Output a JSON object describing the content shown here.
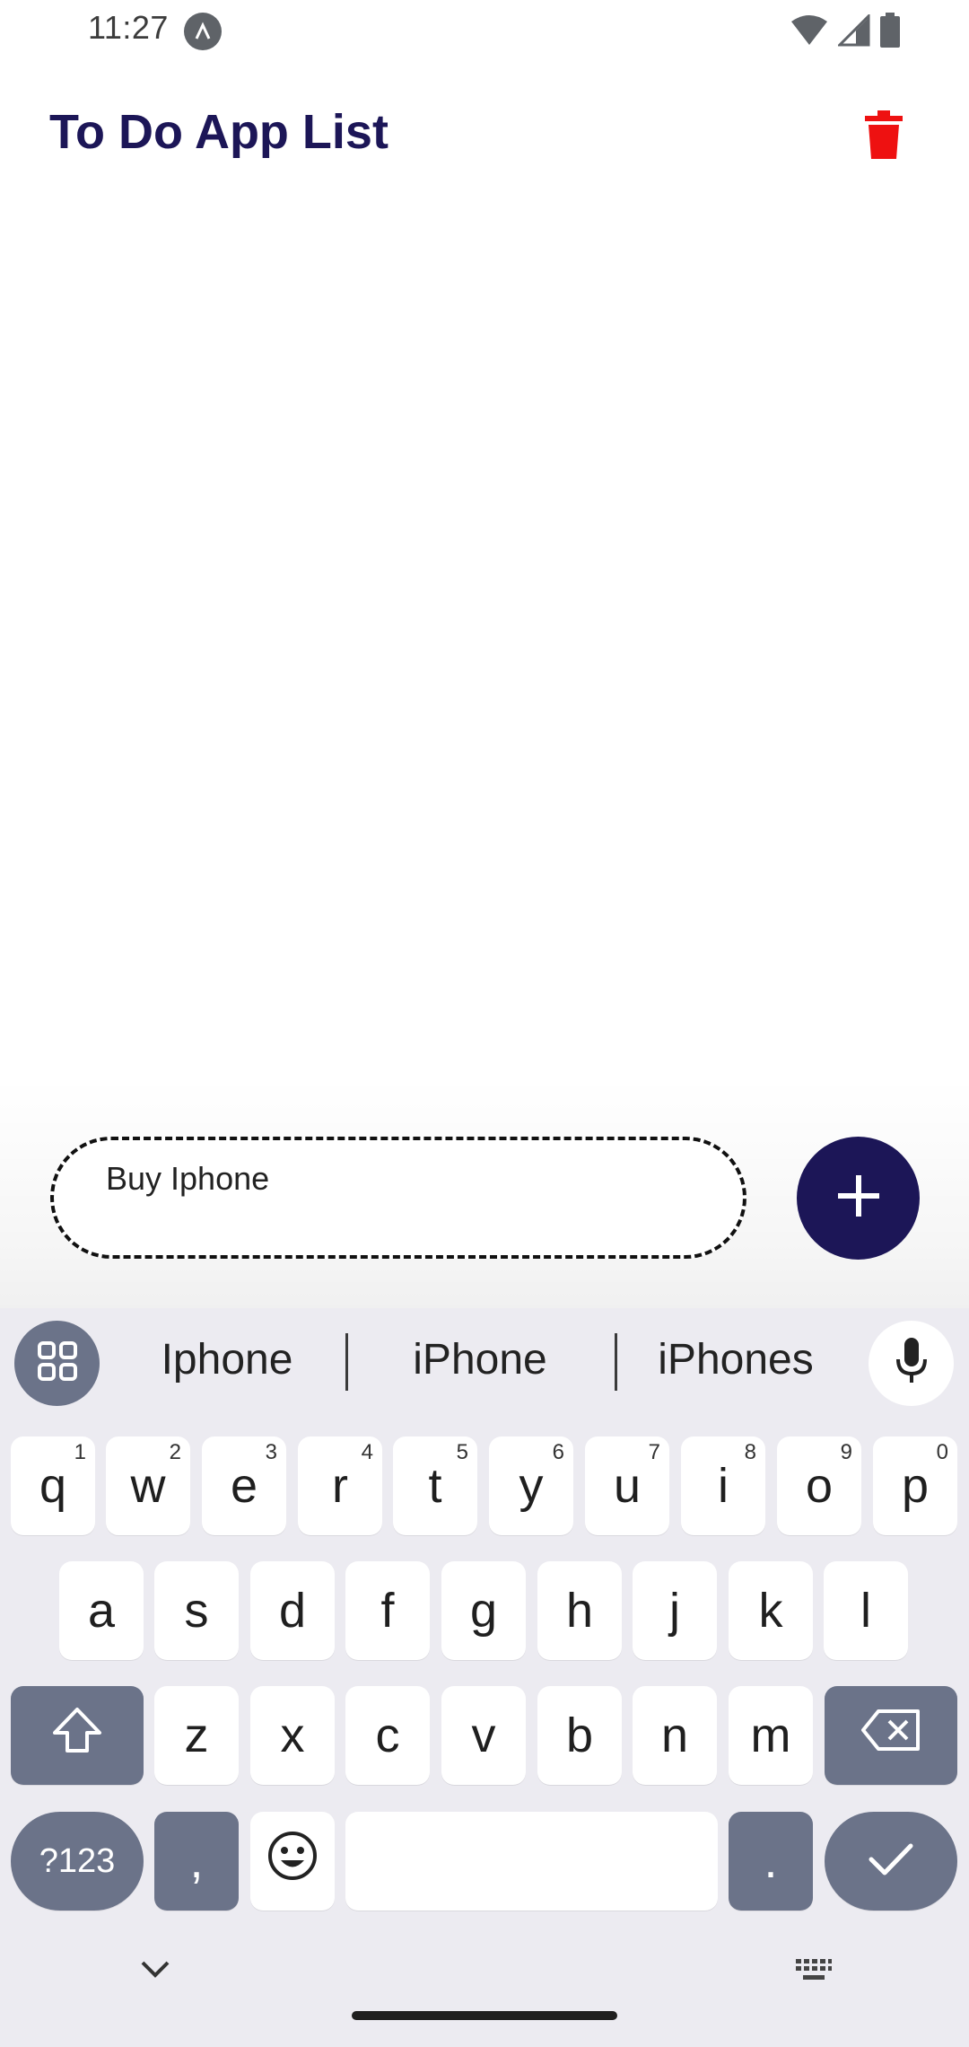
{
  "status_bar": {
    "time": "11:27"
  },
  "app_bar": {
    "title": "To Do App List"
  },
  "task_input": {
    "value": "Buy Iphone"
  },
  "keyboard": {
    "suggestions": [
      "Iphone",
      "iPhone",
      "iPhones"
    ],
    "row1": [
      {
        "key": "q",
        "sup": "1"
      },
      {
        "key": "w",
        "sup": "2"
      },
      {
        "key": "e",
        "sup": "3"
      },
      {
        "key": "r",
        "sup": "4"
      },
      {
        "key": "t",
        "sup": "5"
      },
      {
        "key": "y",
        "sup": "6"
      },
      {
        "key": "u",
        "sup": "7"
      },
      {
        "key": "i",
        "sup": "8"
      },
      {
        "key": "o",
        "sup": "9"
      },
      {
        "key": "p",
        "sup": "0"
      }
    ],
    "row2": [
      "a",
      "s",
      "d",
      "f",
      "g",
      "h",
      "j",
      "k",
      "l"
    ],
    "row3": [
      "z",
      "x",
      "c",
      "v",
      "b",
      "n",
      "m"
    ],
    "symbols_label": "?123",
    "comma": ",",
    "period": "."
  },
  "colors": {
    "title": "#1c1657",
    "accent": "#1c1657",
    "delete": "#ee1111",
    "keyboard_bg": "#ecebf1",
    "key_dark": "#6b7389"
  }
}
